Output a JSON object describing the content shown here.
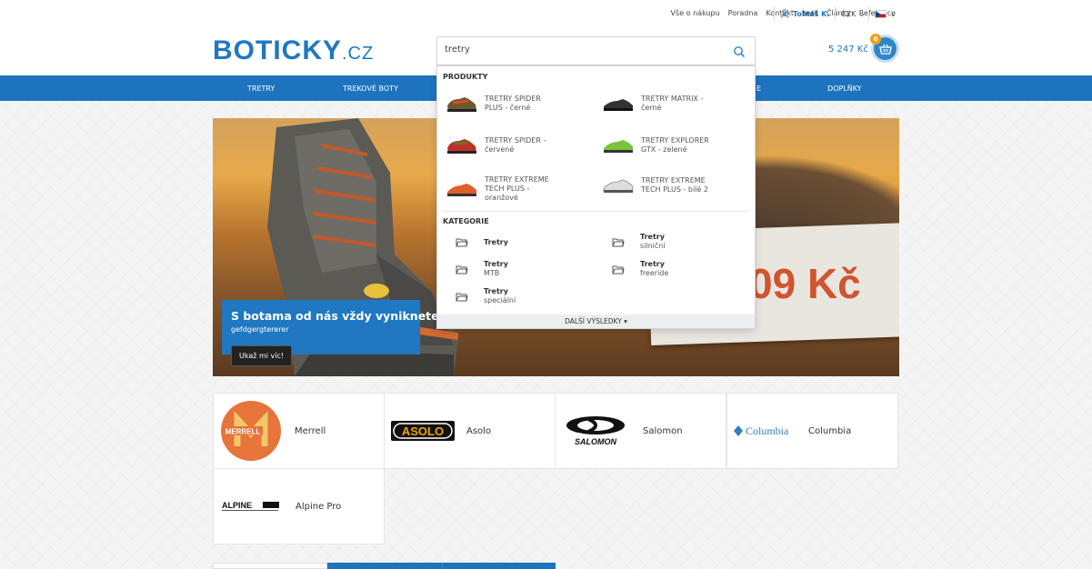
{
  "topbar": {
    "links": [
      "Vše o nákupu",
      "Poradna",
      "Kontakt",
      "test",
      "Články",
      "Reference"
    ],
    "user_name": "Tomáš K.",
    "currency": "CZK"
  },
  "header": {
    "logo_main": "BOTICKY",
    "logo_tld": ".CZ",
    "search_value": "tretry",
    "cart_total": "5 247 Kč",
    "cart_count": "0"
  },
  "nav": {
    "items": [
      "TRETRY",
      "TREKOVÉ BOTY",
      "E",
      "DOPLŇKY"
    ]
  },
  "dropdown": {
    "products_heading": "PRODUKTY",
    "products": [
      {
        "line1": "TRETRY SPIDER",
        "line2": "PLUS - černé",
        "line3": ""
      },
      {
        "line1": "TRETRY MATRIX -",
        "line2": "černé",
        "line3": ""
      },
      {
        "line1": "TRETRY SPIDER -",
        "line2": "červené",
        "line3": ""
      },
      {
        "line1": "TRETRY EXPLORER",
        "line2": "GTX - zelené",
        "line3": ""
      },
      {
        "line1": "TRETRY EXTREME",
        "line2": "TECH PLUS -",
        "line3": "oranžové"
      },
      {
        "line1": "TRETRY EXTREME",
        "line2": "TECH PLUS - bílé 2",
        "line3": ""
      }
    ],
    "categories_heading": "KATEGORIE",
    "categories": [
      {
        "name": "Tretry",
        "sub": ""
      },
      {
        "name": "Tretry",
        "sub": "silniční"
      },
      {
        "name": "Tretry",
        "sub": "MTB"
      },
      {
        "name": "Tretry",
        "sub": "freeride"
      },
      {
        "name": "Tretry",
        "sub": "speciální"
      }
    ],
    "more_label": "DALŠÍ VÝSLEDKY ▾"
  },
  "banner": {
    "title": "S botama od nás vždy vyniknete!",
    "subtitle": "gefdgergtererer",
    "button": "Ukaž mi víc!",
    "price_fragment": "09 Kč"
  },
  "brands": [
    {
      "name": "Merrell",
      "logo_text": "MERRELL"
    },
    {
      "name": "Asolo",
      "logo_text": "ASOLO"
    },
    {
      "name": "Salomon",
      "logo_text": "SALOMON"
    },
    {
      "name": "Columbia",
      "logo_text": "Columbia"
    },
    {
      "name": "Alpine Pro",
      "logo_text": "ALPINE"
    }
  ],
  "colors": {
    "brand_blue": "#1e73be",
    "cart_badge": "#f39c12",
    "price_red": "#d0542f"
  }
}
